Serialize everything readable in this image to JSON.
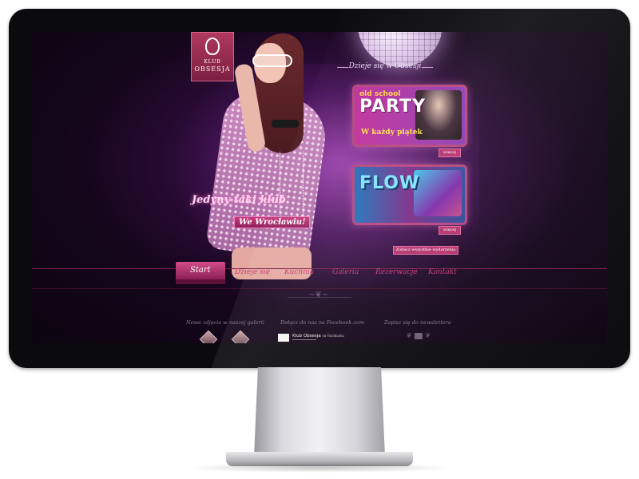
{
  "site": {
    "logo": {
      "line1": "KLUB",
      "line2": "OBSESJA"
    },
    "tagline": "Dzieje się w Obsesji",
    "promos": [
      {
        "subtitle": "old school",
        "title": "PARTY",
        "day": "W każdy piątek",
        "more": "więcej"
      },
      {
        "title": "FLOW",
        "more": "więcej"
      }
    ],
    "slogan": {
      "line1": "Jedyny taki klub",
      "line2": "We Wrocławiu!"
    },
    "all_events": "Zobacz wszystkie wydarzenia",
    "nav": [
      {
        "label": "Start",
        "active": true
      },
      {
        "label": "Dzieje się"
      },
      {
        "label": "Kuchnia"
      },
      {
        "label": "Galeria"
      },
      {
        "label": "Rezerwacje"
      },
      {
        "label": "Kontakt"
      }
    ],
    "footer": {
      "gallery_heading": "Nowe zdjęcia w naszej galerii",
      "facebook_heading": "Dołącz do nas na Facebook.com",
      "facebook_name": "Klub Obsesja",
      "facebook_suffix": "na Facebooku",
      "newsletter_heading": "Zapisz się do newslettera"
    }
  },
  "colors": {
    "accent": "#c3386d",
    "background": "#16061c",
    "monitor_bezel": "#0b0b0d"
  }
}
